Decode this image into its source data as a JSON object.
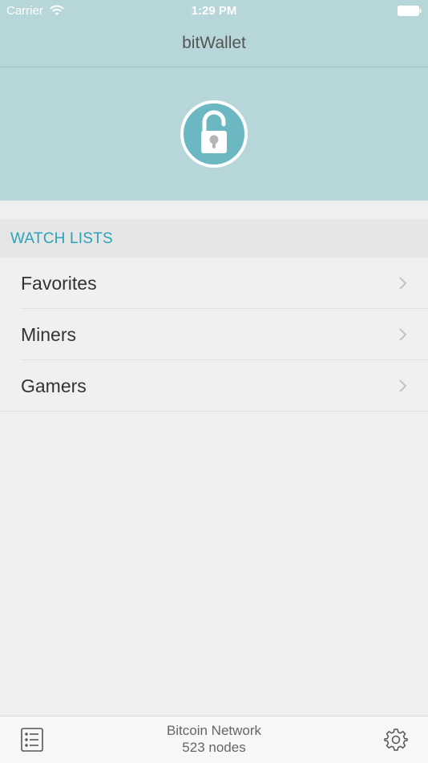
{
  "status_bar": {
    "carrier": "Carrier",
    "time": "1:29 PM",
    "wifi_icon": "wifi-icon",
    "battery_icon": "battery-icon"
  },
  "nav": {
    "title": "bitWallet"
  },
  "lock": {
    "icon": "lock-open-icon",
    "accent_color": "#6bb8c2"
  },
  "watch_lists": {
    "header": "WATCH LISTS",
    "items": [
      {
        "label": "Favorites"
      },
      {
        "label": "Miners"
      },
      {
        "label": "Gamers"
      }
    ]
  },
  "bottom_bar": {
    "list_icon": "list-icon",
    "settings_icon": "gear-icon",
    "network_name": "Bitcoin Network",
    "node_count": "523 nodes"
  },
  "colors": {
    "header_background": "#b7d6da",
    "section_title": "#2aa3b8",
    "page_background": "#efefef"
  }
}
